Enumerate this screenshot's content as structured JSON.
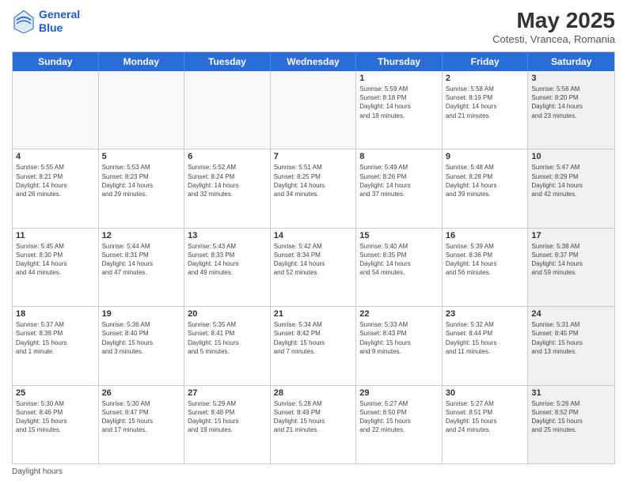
{
  "logo": {
    "line1": "General",
    "line2": "Blue"
  },
  "title": {
    "month_year": "May 2025",
    "subtitle": "Cotesti, Vrancea, Romania"
  },
  "header_days": [
    "Sunday",
    "Monday",
    "Tuesday",
    "Wednesday",
    "Thursday",
    "Friday",
    "Saturday"
  ],
  "weeks": [
    [
      {
        "day": "",
        "info": "",
        "shaded": true
      },
      {
        "day": "",
        "info": "",
        "shaded": true
      },
      {
        "day": "",
        "info": "",
        "shaded": true
      },
      {
        "day": "",
        "info": "",
        "shaded": true
      },
      {
        "day": "1",
        "info": "Sunrise: 5:59 AM\nSunset: 8:18 PM\nDaylight: 14 hours\nand 18 minutes.",
        "shaded": false
      },
      {
        "day": "2",
        "info": "Sunrise: 5:58 AM\nSunset: 8:19 PM\nDaylight: 14 hours\nand 21 minutes.",
        "shaded": false
      },
      {
        "day": "3",
        "info": "Sunrise: 5:56 AM\nSunset: 8:20 PM\nDaylight: 14 hours\nand 23 minutes.",
        "shaded": true
      }
    ],
    [
      {
        "day": "4",
        "info": "Sunrise: 5:55 AM\nSunset: 8:21 PM\nDaylight: 14 hours\nand 26 minutes.",
        "shaded": false
      },
      {
        "day": "5",
        "info": "Sunrise: 5:53 AM\nSunset: 8:23 PM\nDaylight: 14 hours\nand 29 minutes.",
        "shaded": false
      },
      {
        "day": "6",
        "info": "Sunrise: 5:52 AM\nSunset: 8:24 PM\nDaylight: 14 hours\nand 32 minutes.",
        "shaded": false
      },
      {
        "day": "7",
        "info": "Sunrise: 5:51 AM\nSunset: 8:25 PM\nDaylight: 14 hours\nand 34 minutes.",
        "shaded": false
      },
      {
        "day": "8",
        "info": "Sunrise: 5:49 AM\nSunset: 8:26 PM\nDaylight: 14 hours\nand 37 minutes.",
        "shaded": false
      },
      {
        "day": "9",
        "info": "Sunrise: 5:48 AM\nSunset: 8:28 PM\nDaylight: 14 hours\nand 39 minutes.",
        "shaded": false
      },
      {
        "day": "10",
        "info": "Sunrise: 5:47 AM\nSunset: 8:29 PM\nDaylight: 14 hours\nand 42 minutes.",
        "shaded": true
      }
    ],
    [
      {
        "day": "11",
        "info": "Sunrise: 5:45 AM\nSunset: 8:30 PM\nDaylight: 14 hours\nand 44 minutes.",
        "shaded": false
      },
      {
        "day": "12",
        "info": "Sunrise: 5:44 AM\nSunset: 8:31 PM\nDaylight: 14 hours\nand 47 minutes.",
        "shaded": false
      },
      {
        "day": "13",
        "info": "Sunrise: 5:43 AM\nSunset: 8:33 PM\nDaylight: 14 hours\nand 49 minutes.",
        "shaded": false
      },
      {
        "day": "14",
        "info": "Sunrise: 5:42 AM\nSunset: 8:34 PM\nDaylight: 14 hours\nand 52 minutes.",
        "shaded": false
      },
      {
        "day": "15",
        "info": "Sunrise: 5:40 AM\nSunset: 8:35 PM\nDaylight: 14 hours\nand 54 minutes.",
        "shaded": false
      },
      {
        "day": "16",
        "info": "Sunrise: 5:39 AM\nSunset: 8:36 PM\nDaylight: 14 hours\nand 56 minutes.",
        "shaded": false
      },
      {
        "day": "17",
        "info": "Sunrise: 5:38 AM\nSunset: 8:37 PM\nDaylight: 14 hours\nand 59 minutes.",
        "shaded": true
      }
    ],
    [
      {
        "day": "18",
        "info": "Sunrise: 5:37 AM\nSunset: 8:38 PM\nDaylight: 15 hours\nand 1 minute.",
        "shaded": false
      },
      {
        "day": "19",
        "info": "Sunrise: 5:36 AM\nSunset: 8:40 PM\nDaylight: 15 hours\nand 3 minutes.",
        "shaded": false
      },
      {
        "day": "20",
        "info": "Sunrise: 5:35 AM\nSunset: 8:41 PM\nDaylight: 15 hours\nand 5 minutes.",
        "shaded": false
      },
      {
        "day": "21",
        "info": "Sunrise: 5:34 AM\nSunset: 8:42 PM\nDaylight: 15 hours\nand 7 minutes.",
        "shaded": false
      },
      {
        "day": "22",
        "info": "Sunrise: 5:33 AM\nSunset: 8:43 PM\nDaylight: 15 hours\nand 9 minutes.",
        "shaded": false
      },
      {
        "day": "23",
        "info": "Sunrise: 5:32 AM\nSunset: 8:44 PM\nDaylight: 15 hours\nand 11 minutes.",
        "shaded": false
      },
      {
        "day": "24",
        "info": "Sunrise: 5:31 AM\nSunset: 8:45 PM\nDaylight: 15 hours\nand 13 minutes.",
        "shaded": true
      }
    ],
    [
      {
        "day": "25",
        "info": "Sunrise: 5:30 AM\nSunset: 8:46 PM\nDaylight: 15 hours\nand 15 minutes.",
        "shaded": false
      },
      {
        "day": "26",
        "info": "Sunrise: 5:30 AM\nSunset: 8:47 PM\nDaylight: 15 hours\nand 17 minutes.",
        "shaded": false
      },
      {
        "day": "27",
        "info": "Sunrise: 5:29 AM\nSunset: 8:48 PM\nDaylight: 15 hours\nand 19 minutes.",
        "shaded": false
      },
      {
        "day": "28",
        "info": "Sunrise: 5:28 AM\nSunset: 8:49 PM\nDaylight: 15 hours\nand 21 minutes.",
        "shaded": false
      },
      {
        "day": "29",
        "info": "Sunrise: 5:27 AM\nSunset: 8:50 PM\nDaylight: 15 hours\nand 22 minutes.",
        "shaded": false
      },
      {
        "day": "30",
        "info": "Sunrise: 5:27 AM\nSunset: 8:51 PM\nDaylight: 15 hours\nand 24 minutes.",
        "shaded": false
      },
      {
        "day": "31",
        "info": "Sunrise: 5:26 AM\nSunset: 8:52 PM\nDaylight: 15 hours\nand 25 minutes.",
        "shaded": true
      }
    ]
  ],
  "footer": "Daylight hours"
}
